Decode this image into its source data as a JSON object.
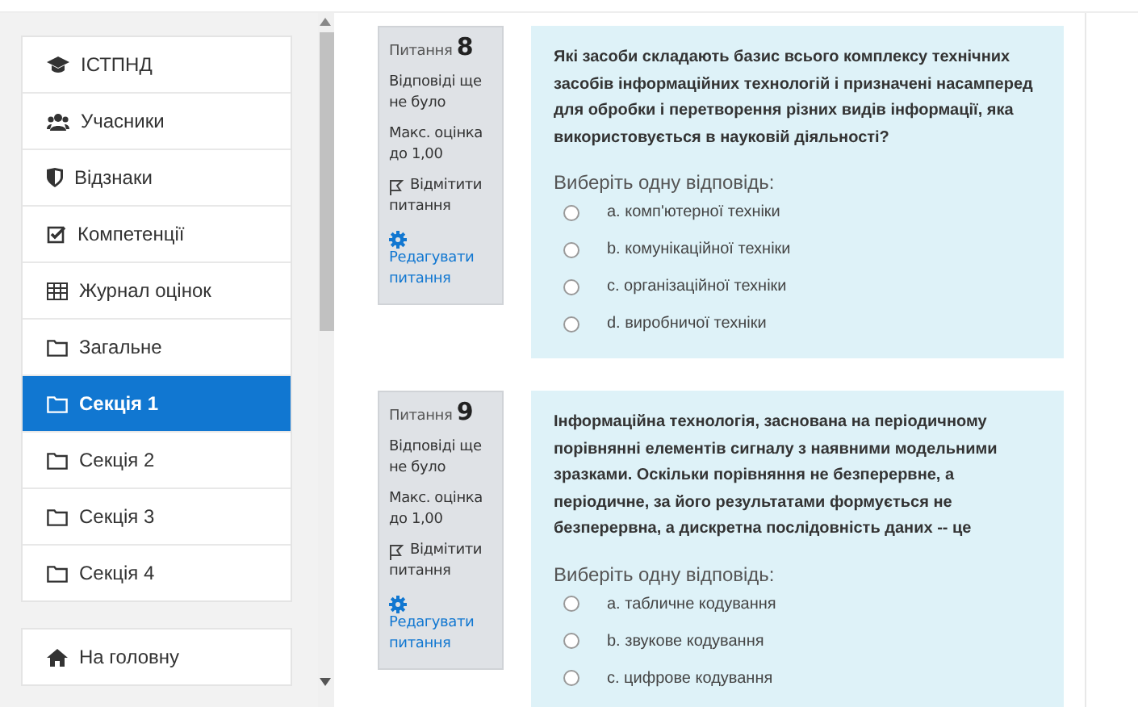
{
  "sidebar": {
    "items": [
      {
        "label": "ІСТПНД",
        "selected": false
      },
      {
        "label": "Учасники",
        "selected": false
      },
      {
        "label": "Відзнаки",
        "selected": false
      },
      {
        "label": "Компетенції",
        "selected": false
      },
      {
        "label": "Журнал оцінок",
        "selected": false
      },
      {
        "label": "Загальне",
        "selected": false
      },
      {
        "label": "Секція 1",
        "selected": true
      },
      {
        "label": "Секція 2",
        "selected": false
      },
      {
        "label": "Секція 3",
        "selected": false
      },
      {
        "label": "Секція 4",
        "selected": false
      }
    ],
    "bottom_items": [
      {
        "label": "На головну",
        "selected": false
      }
    ]
  },
  "questions": [
    {
      "label": "Питання",
      "number": "8",
      "status": "Відповіді ще не було",
      "max_grade": "Макс. оцінка до 1,00",
      "flag": "Відмітити питання",
      "edit": "Редагувати питання",
      "text": "Які засоби складають базис всього комплексу технічних засобів інформаційних технологій і призначені насамперед для обробки і перетворення різних видів інформації, яка використовується в науковій діяльності?",
      "prompt": "Виберіть одну відповідь:",
      "answers": [
        {
          "label": "a. комп'ютерної техніки",
          "selected": false
        },
        {
          "label": "b. комунікаційної техніки",
          "selected": false
        },
        {
          "label": "c. організаційної техніки",
          "selected": false
        },
        {
          "label": "d. виробничої техніки",
          "selected": false
        }
      ]
    },
    {
      "label": "Питання",
      "number": "9",
      "status": "Відповіді ще не було",
      "max_grade": "Макс. оцінка до 1,00",
      "flag": "Відмітити питання",
      "edit": "Редагувати питання",
      "text": "Інформаційна технологія, заснована на періодичному порівнянні елементів сигналу з наявними модельними зразками. Оскільки порівняння не безперервне, а періодичне, за його результатами формується не безперервна, а дискретна послідовність даних -- це",
      "prompt": "Виберіть одну відповідь:",
      "answers": [
        {
          "label": "a. табличне кодування",
          "selected": false
        },
        {
          "label": "b. звукове кодування",
          "selected": false
        },
        {
          "label": "c. цифрове кодування",
          "selected": false
        }
      ]
    }
  ]
}
